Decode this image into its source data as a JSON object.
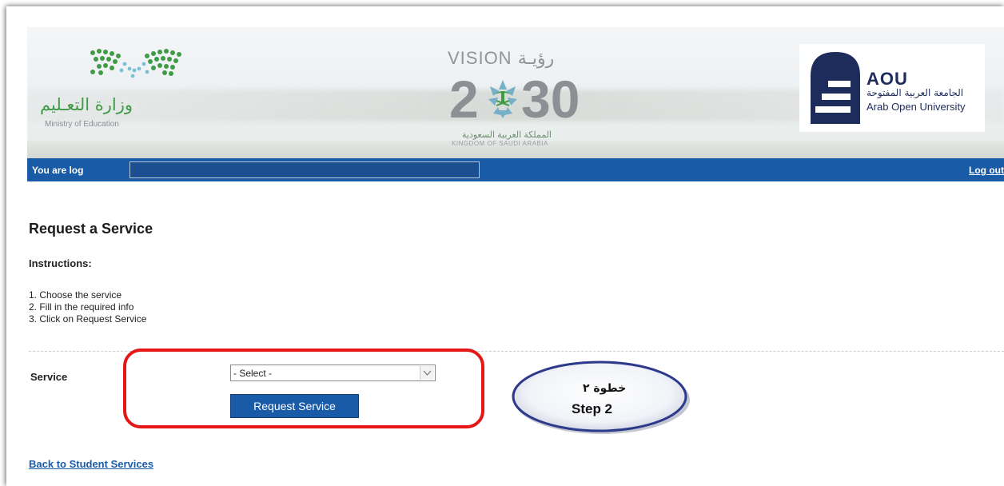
{
  "header": {
    "moe_name_ar": "وزارة التعـليم",
    "moe_name_en": "Ministry of Education",
    "vision_title": "VISION رؤيـة",
    "vision_year_left": "2",
    "vision_year_right": "30",
    "vision_kingdom_ar": "المملكة العربية السعودية",
    "vision_kingdom_en": "KINGDOM OF SAUDI ARABIA",
    "aou_abbr": "AOU",
    "aou_name_ar": "الجامعة العربية المفتوحة",
    "aou_name_en": "Arab Open University"
  },
  "status_bar": {
    "logged_text": "You are log",
    "logout_label": "Log out",
    "color": "#1a5ba8"
  },
  "page": {
    "title": "Request a Service",
    "instructions_label": "Instructions:",
    "steps": [
      "1. Choose the service",
      "2. Fill in the required info",
      "3. Click on Request Service"
    ]
  },
  "form": {
    "service_label": "Service",
    "service_select_value": "- Select -",
    "request_button_label": "Request Service"
  },
  "annotation": {
    "step_ar": "خطوة ٢",
    "step_en": "Step 2",
    "highlight_color": "#e41616"
  },
  "footer": {
    "back_link_label": "Back to Student Services"
  }
}
